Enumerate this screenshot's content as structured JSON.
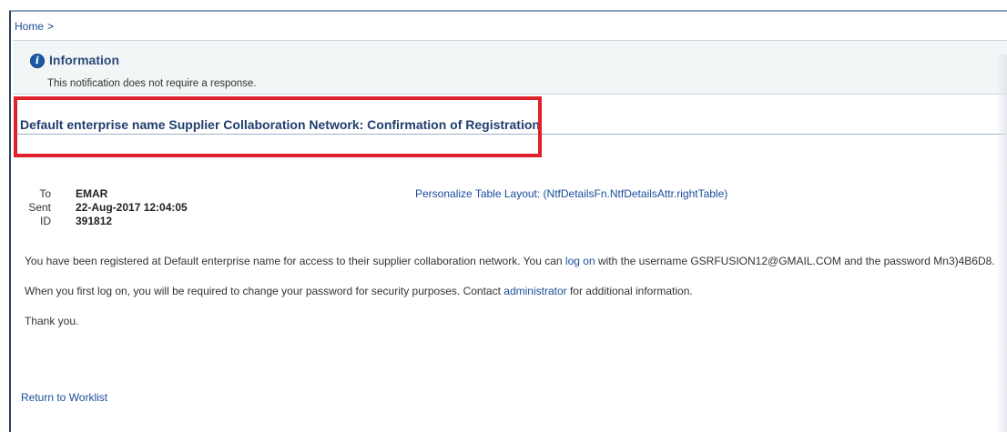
{
  "breadcrumb": {
    "home": "Home",
    "separator": ">"
  },
  "info": {
    "icon": "info-icon",
    "title": "Information",
    "message": "This notification does not require a response."
  },
  "subject": "Default enterprise name Supplier Collaboration Network: Confirmation of Registration",
  "highlight_color": "#e0202a",
  "details": {
    "to_label": "To",
    "to_value": "EMAR",
    "sent_label": "Sent",
    "sent_value": "22-Aug-2017 12:04:05",
    "id_label": "ID",
    "id_value": "391812"
  },
  "personalize_link": "Personalize Table Layout: (NtfDetailsFn.NtfDetailsAttr.rightTable)",
  "body": {
    "line1_pre": "You have been registered at Default enterprise name for access to their supplier collaboration network. You can ",
    "line1_link": "log on",
    "line1_post": " with the username GSRFUSION12@GMAIL.COM and the password Mn3)4B6D8.",
    "line2_pre": "When you first log on, you will be required to change your password for security purposes. Contact ",
    "line2_link": "administrator",
    "line2_post": " for additional information.",
    "line3": "Thank you."
  },
  "return_link": "Return to Worklist"
}
